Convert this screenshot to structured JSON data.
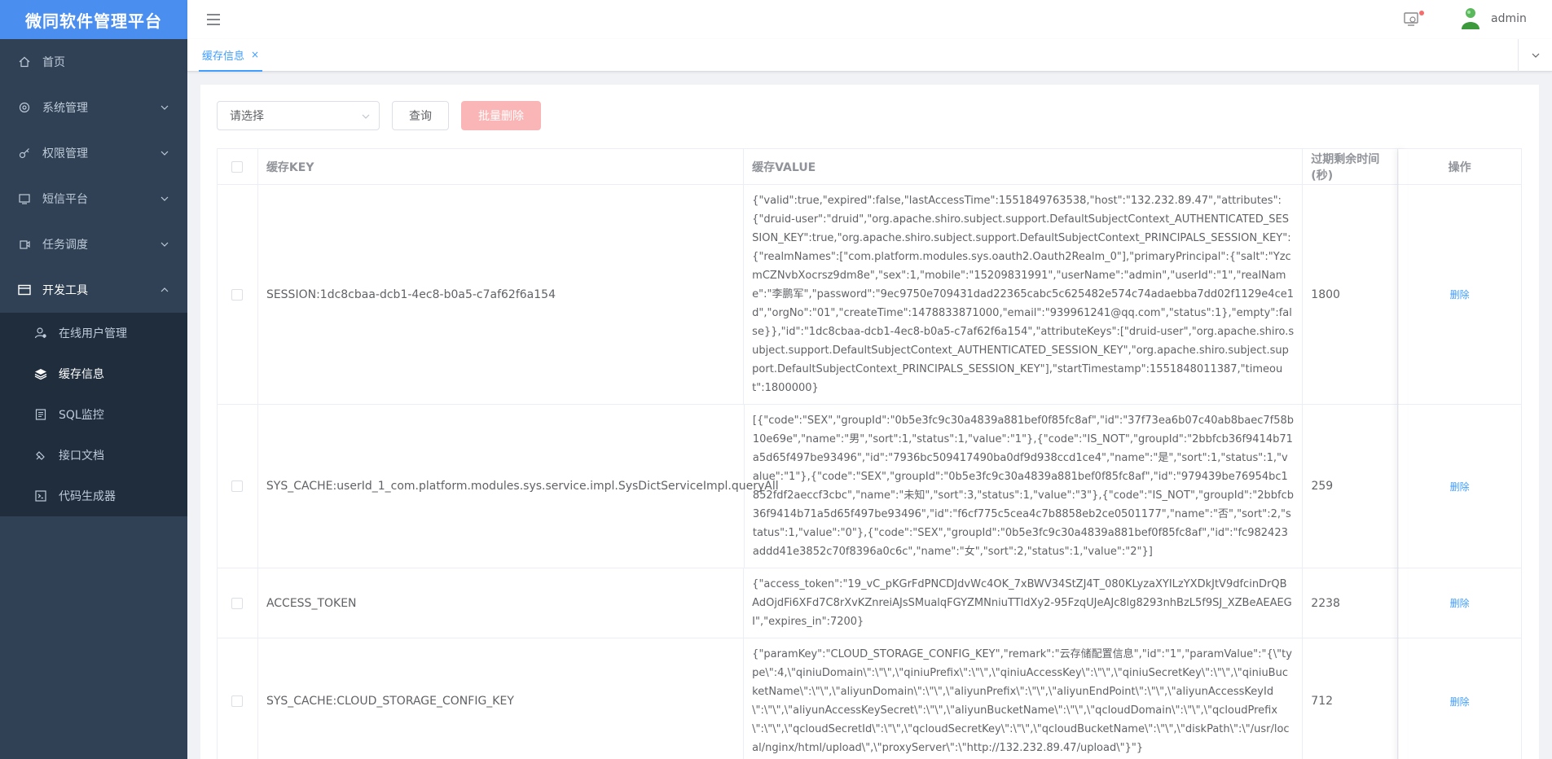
{
  "app": {
    "title": "微同软件管理平台"
  },
  "sidebar": {
    "items": [
      {
        "label": "首页",
        "icon": "home-icon"
      },
      {
        "label": "系统管理",
        "icon": "gear-icon"
      },
      {
        "label": "权限管理",
        "icon": "key-icon"
      },
      {
        "label": "短信平台",
        "icon": "message-icon"
      },
      {
        "label": "任务调度",
        "icon": "schedule-icon"
      },
      {
        "label": "开发工具",
        "icon": "toolbox-icon"
      }
    ],
    "subitems": [
      {
        "label": "在线用户管理",
        "icon": "user-online-icon"
      },
      {
        "label": "缓存信息",
        "icon": "layers-icon"
      },
      {
        "label": "SQL监控",
        "icon": "monitor-icon"
      },
      {
        "label": "接口文档",
        "icon": "api-doc-icon"
      },
      {
        "label": "代码生成器",
        "icon": "code-icon"
      }
    ]
  },
  "header": {
    "user": "admin"
  },
  "tags": [
    {
      "label": "缓存信息",
      "close": "×"
    }
  ],
  "toolbar": {
    "select_placeholder": "请选择",
    "query_label": "查询",
    "batch_delete_label": "批量删除"
  },
  "table": {
    "columns": [
      "缓存KEY",
      "缓存VALUE",
      "过期剩余时间(秒)",
      "操作"
    ],
    "rows": [
      {
        "key": "SESSION:1dc8cbaa-dcb1-4ec8-b0a5-c7af62f6a154",
        "value": "{\"valid\":true,\"expired\":false,\"lastAccessTime\":1551849763538,\"host\":\"132.232.89.47\",\"attributes\":{\"druid-user\":\"druid\",\"org.apache.shiro.subject.support.DefaultSubjectContext_AUTHENTICATED_SESSION_KEY\":true,\"org.apache.shiro.subject.support.DefaultSubjectContext_PRINCIPALS_SESSION_KEY\":{\"realmNames\":[\"com.platform.modules.sys.oauth2.Oauth2Realm_0\"],\"primaryPrincipal\":{\"salt\":\"YzcmCZNvbXocrsz9dm8e\",\"sex\":1,\"mobile\":\"15209831991\",\"userName\":\"admin\",\"userId\":\"1\",\"realName\":\"李鹏军\",\"password\":\"9ec9750e709431dad22365cabc5c625482e574c74adaebba7dd02f1129e4ce1d\",\"orgNo\":\"01\",\"createTime\":1478833871000,\"email\":\"939961241@qq.com\",\"status\":1},\"empty\":false}},\"id\":\"1dc8cbaa-dcb1-4ec8-b0a5-c7af62f6a154\",\"attributeKeys\":[\"druid-user\",\"org.apache.shiro.subject.support.DefaultSubjectContext_AUTHENTICATED_SESSION_KEY\",\"org.apache.shiro.subject.support.DefaultSubjectContext_PRINCIPALS_SESSION_KEY\"],\"startTimestamp\":1551848011387,\"timeout\":1800000}",
        "expire": "1800",
        "action": "删除"
      },
      {
        "key": "SYS_CACHE:userId_1_com.platform.modules.sys.service.impl.SysDictServiceImpl.queryAll",
        "value": "[{\"code\":\"SEX\",\"groupId\":\"0b5e3fc9c30a4839a881bef0f85fc8af\",\"id\":\"37f73ea6b07c40ab8baec7f58b10e69e\",\"name\":\"男\",\"sort\":1,\"status\":1,\"value\":\"1\"},{\"code\":\"IS_NOT\",\"groupId\":\"2bbfcb36f9414b71a5d65f497be93496\",\"id\":\"7936bc509417490ba0df9d938ccd1ce4\",\"name\":\"是\",\"sort\":1,\"status\":1,\"value\":\"1\"},{\"code\":\"SEX\",\"groupId\":\"0b5e3fc9c30a4839a881bef0f85fc8af\",\"id\":\"979439be76954bc1852fdf2aeccf3cbc\",\"name\":\"未知\",\"sort\":3,\"status\":1,\"value\":\"3\"},{\"code\":\"IS_NOT\",\"groupId\":\"2bbfcb36f9414b71a5d65f497be93496\",\"id\":\"f6cf775c5cea4c7b8858eb2ce0501177\",\"name\":\"否\",\"sort\":2,\"status\":1,\"value\":\"0\"},{\"code\":\"SEX\",\"groupId\":\"0b5e3fc9c30a4839a881bef0f85fc8af\",\"id\":\"fc982423addd41e3852c70f8396a0c6c\",\"name\":\"女\",\"sort\":2,\"status\":1,\"value\":\"2\"}]",
        "expire": "259",
        "action": "删除"
      },
      {
        "key": "ACCESS_TOKEN",
        "value": "{\"access_token\":\"19_vC_pKGrFdPNCDJdvWc4OK_7xBWV34StZJ4T_080KLyzaXYILzYXDkJtV9dfcinDrQBAdOjdFi6XFd7C8rXvKZnreiAJsSMualqFGYZMNniuTTldXy2-95FzqUJeAJc8lg8293nhBzL5f9SJ_XZBeAEAEGI\",\"expires_in\":7200}",
        "expire": "2238",
        "action": "删除"
      },
      {
        "key": "SYS_CACHE:CLOUD_STORAGE_CONFIG_KEY",
        "value": "{\"paramKey\":\"CLOUD_STORAGE_CONFIG_KEY\",\"remark\":\"云存储配置信息\",\"id\":\"1\",\"paramValue\":\"{\\\"type\\\":4,\\\"qiniuDomain\\\":\\\"\\\",\\\"qiniuPrefix\\\":\\\"\\\",\\\"qiniuAccessKey\\\":\\\"\\\",\\\"qiniuSecretKey\\\":\\\"\\\",\\\"qiniuBucketName\\\":\\\"\\\",\\\"aliyunDomain\\\":\\\"\\\",\\\"aliyunPrefix\\\":\\\"\\\",\\\"aliyunEndPoint\\\":\\\"\\\",\\\"aliyunAccessKeyId\\\":\\\"\\\",\\\"aliyunAccessKeySecret\\\":\\\"\\\",\\\"aliyunBucketName\\\":\\\"\\\",\\\"qcloudDomain\\\":\\\"\\\",\\\"qcloudPrefix\\\":\\\"\\\",\\\"qcloudSecretId\\\":\\\"\\\",\\\"qcloudSecretKey\\\":\\\"\\\",\\\"qcloudBucketName\\\":\\\"\\\",\\\"diskPath\\\":\\\"/usr/local/nginx/html/upload\\\",\\\"proxyServer\\\":\\\"http://132.232.89.47/upload\\\"}\"}",
        "expire": "712",
        "action": "删除"
      }
    ]
  },
  "colors": {
    "sidebar": "#304156",
    "logo": "#4a8ff0",
    "primary": "#409eff",
    "danger_light": "#fab6b6"
  }
}
